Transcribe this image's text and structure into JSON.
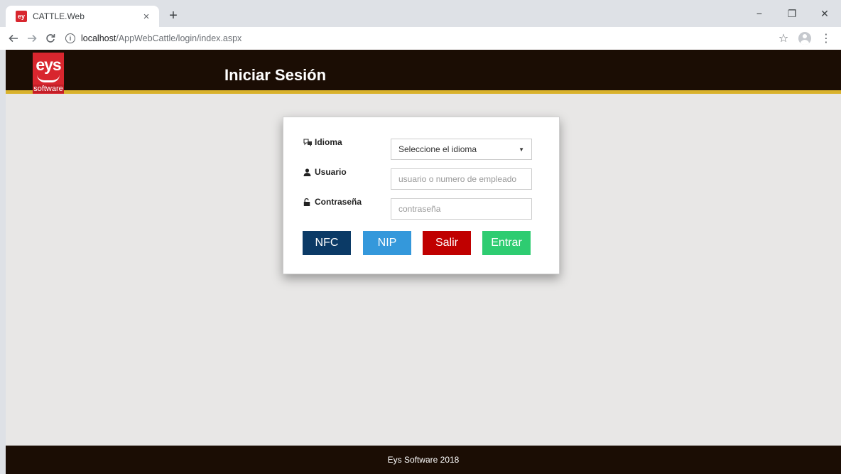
{
  "browser": {
    "tab_title": "CATTLE.Web",
    "tab_close": "×",
    "new_tab": "+",
    "url_host": "localhost",
    "url_path": "/AppWebCattle/login/index.aspx",
    "window_controls": {
      "minimize": "−",
      "restore": "❐",
      "close": "✕"
    }
  },
  "header": {
    "logo_mark": "eys",
    "logo_text": "software",
    "title": "Iniciar Sesión"
  },
  "login": {
    "language_label": "Idioma",
    "language_selected": "Seleccione el idioma",
    "user_label": "Usuario",
    "user_placeholder": "usuario o numero de empleado",
    "password_label": "Contraseña",
    "password_placeholder": "contraseña"
  },
  "buttons": {
    "nfc": "NFC",
    "nip": "NIP",
    "salir": "Salir",
    "entrar": "Entrar"
  },
  "footer": {
    "text": "Eys Software 2018"
  },
  "colors": {
    "header_bg": "#1b0d04",
    "header_accent": "#d9b22c",
    "logo_red": "#d8262e",
    "nfc": "#0b3a66",
    "nip": "#3498db",
    "salir": "#c00000",
    "entrar": "#2ecc71",
    "page_bg": "#e8e7e6"
  },
  "icons": {
    "language": "language-icon",
    "user": "user-icon",
    "password": "unlock-icon"
  }
}
